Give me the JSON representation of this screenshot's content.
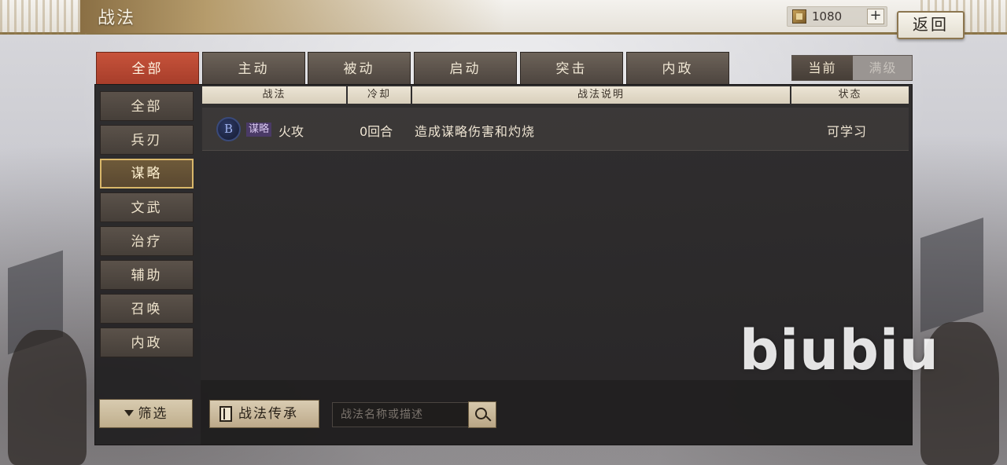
{
  "header": {
    "title": "战法",
    "currency_value": "1080",
    "plus_label": "+",
    "back_label": "返回"
  },
  "tabs": [
    {
      "label": "全部",
      "active": true
    },
    {
      "label": "主动",
      "active": false
    },
    {
      "label": "被动",
      "active": false
    },
    {
      "label": "启动",
      "active": false
    },
    {
      "label": "突击",
      "active": false
    },
    {
      "label": "内政",
      "active": false
    }
  ],
  "level_toggle": {
    "current": "当前",
    "max": "满级"
  },
  "sidebar": {
    "items": [
      {
        "label": "全部"
      },
      {
        "label": "兵刃"
      },
      {
        "label": "谋略",
        "active": true
      },
      {
        "label": "文武"
      },
      {
        "label": "治疗"
      },
      {
        "label": "辅助"
      },
      {
        "label": "召唤"
      },
      {
        "label": "内政"
      }
    ],
    "filter_label": "筛选"
  },
  "table": {
    "headers": [
      "战法",
      "冷却",
      "战法说明",
      "状态"
    ],
    "rows": [
      {
        "grade": "B",
        "type_tag": "谋略",
        "name": "火攻",
        "cooldown": "0回合",
        "description": "造成谋略伤害和灼烧",
        "status": "可学习"
      }
    ]
  },
  "bottom": {
    "inherit_label": "战法传承",
    "search_placeholder": "战法名称或描述"
  },
  "watermark": "biubiu",
  "colors": {
    "active_tab": "#c7533b",
    "active_side_border": "#d9b76a",
    "grade_b": "#2d3a66",
    "type_tag_bg": "#4a3a66"
  }
}
